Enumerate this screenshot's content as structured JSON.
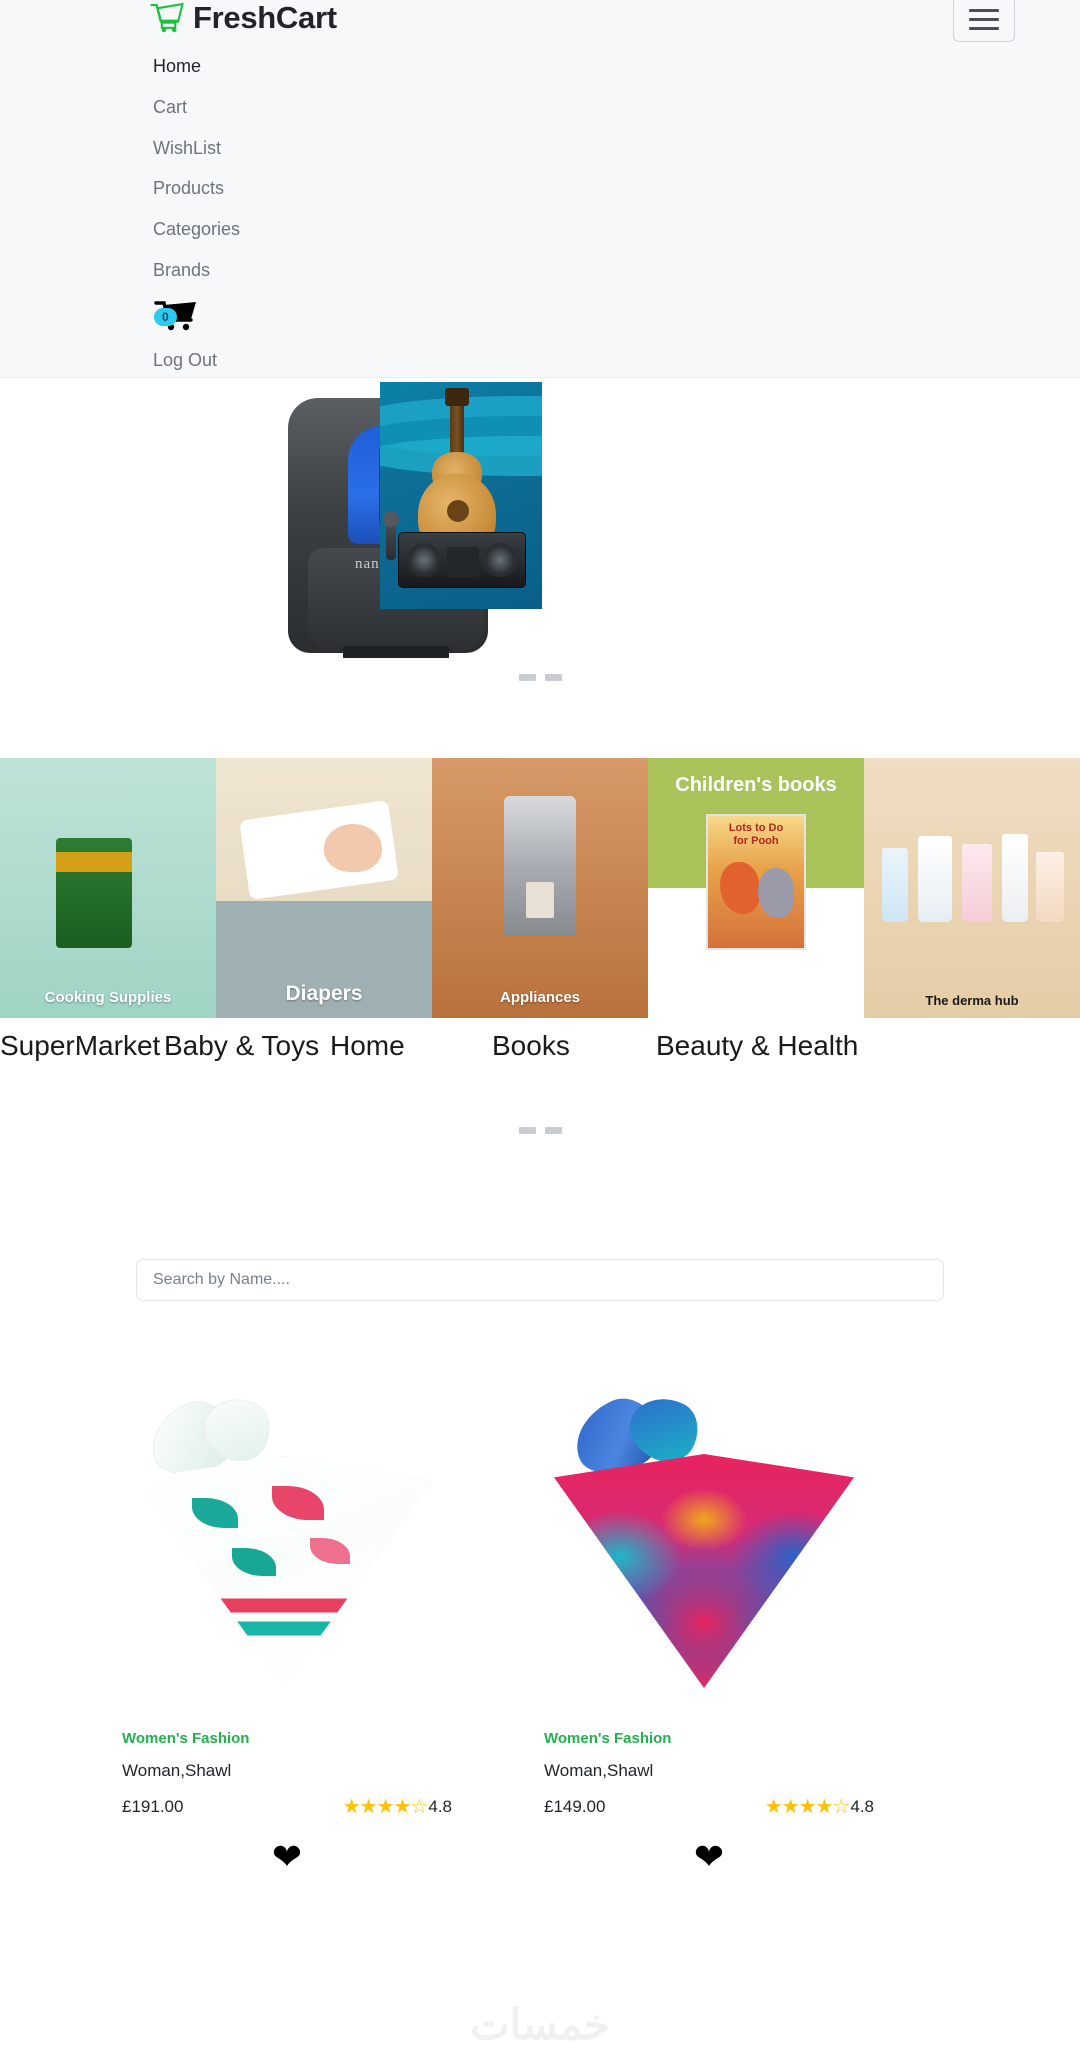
{
  "brand": {
    "name": "FreshCart",
    "icon": "shopping-cart-icon",
    "color": "#1fbf3f"
  },
  "nav": {
    "toggler_label": "menu-toggle",
    "items": [
      {
        "label": "Home",
        "active": true
      },
      {
        "label": "Cart",
        "active": false
      },
      {
        "label": "WishList",
        "active": false
      },
      {
        "label": "Products",
        "active": false
      },
      {
        "label": "Categories",
        "active": false
      },
      {
        "label": "Brands",
        "active": false
      }
    ],
    "cart": {
      "icon": "cart-icon",
      "badge_count": "0",
      "badge_color": "#2ec8f0"
    },
    "logout_label": "Log Out"
  },
  "hero": {
    "slide_dots": 2,
    "active_dot": 0,
    "slides": [
      {
        "alt": "baby-car-seat-banner"
      },
      {
        "alt": "music-instruments-banner"
      }
    ]
  },
  "categories": {
    "dots": 2,
    "active_dot": 0,
    "items": [
      {
        "name": "SuperMarket",
        "image_caption": "Cooking Supplies"
      },
      {
        "name": "Baby & Toys",
        "image_caption": "Diapers"
      },
      {
        "name": "Home",
        "image_caption": "Appliances"
      },
      {
        "name": "Books",
        "image_caption": "Children's books"
      },
      {
        "name": "Beauty & Health",
        "image_caption": "The derma hub"
      }
    ]
  },
  "search": {
    "placeholder": "Search by Name....",
    "value": ""
  },
  "products": [
    {
      "category": "Women's Fashion",
      "name": "Woman,Shawl",
      "price": "£191.00",
      "rating_value": "4.8",
      "stars": "★★★★☆",
      "wishlist_icon": "heart-icon",
      "wishlisted": true
    },
    {
      "category": "Women's Fashion",
      "name": "Woman,Shawl",
      "price": "£149.00",
      "rating_value": "4.8",
      "stars": "★★★★☆",
      "wishlist_icon": "heart-icon",
      "wishlisted": true
    }
  ],
  "watermark": "خمسات"
}
